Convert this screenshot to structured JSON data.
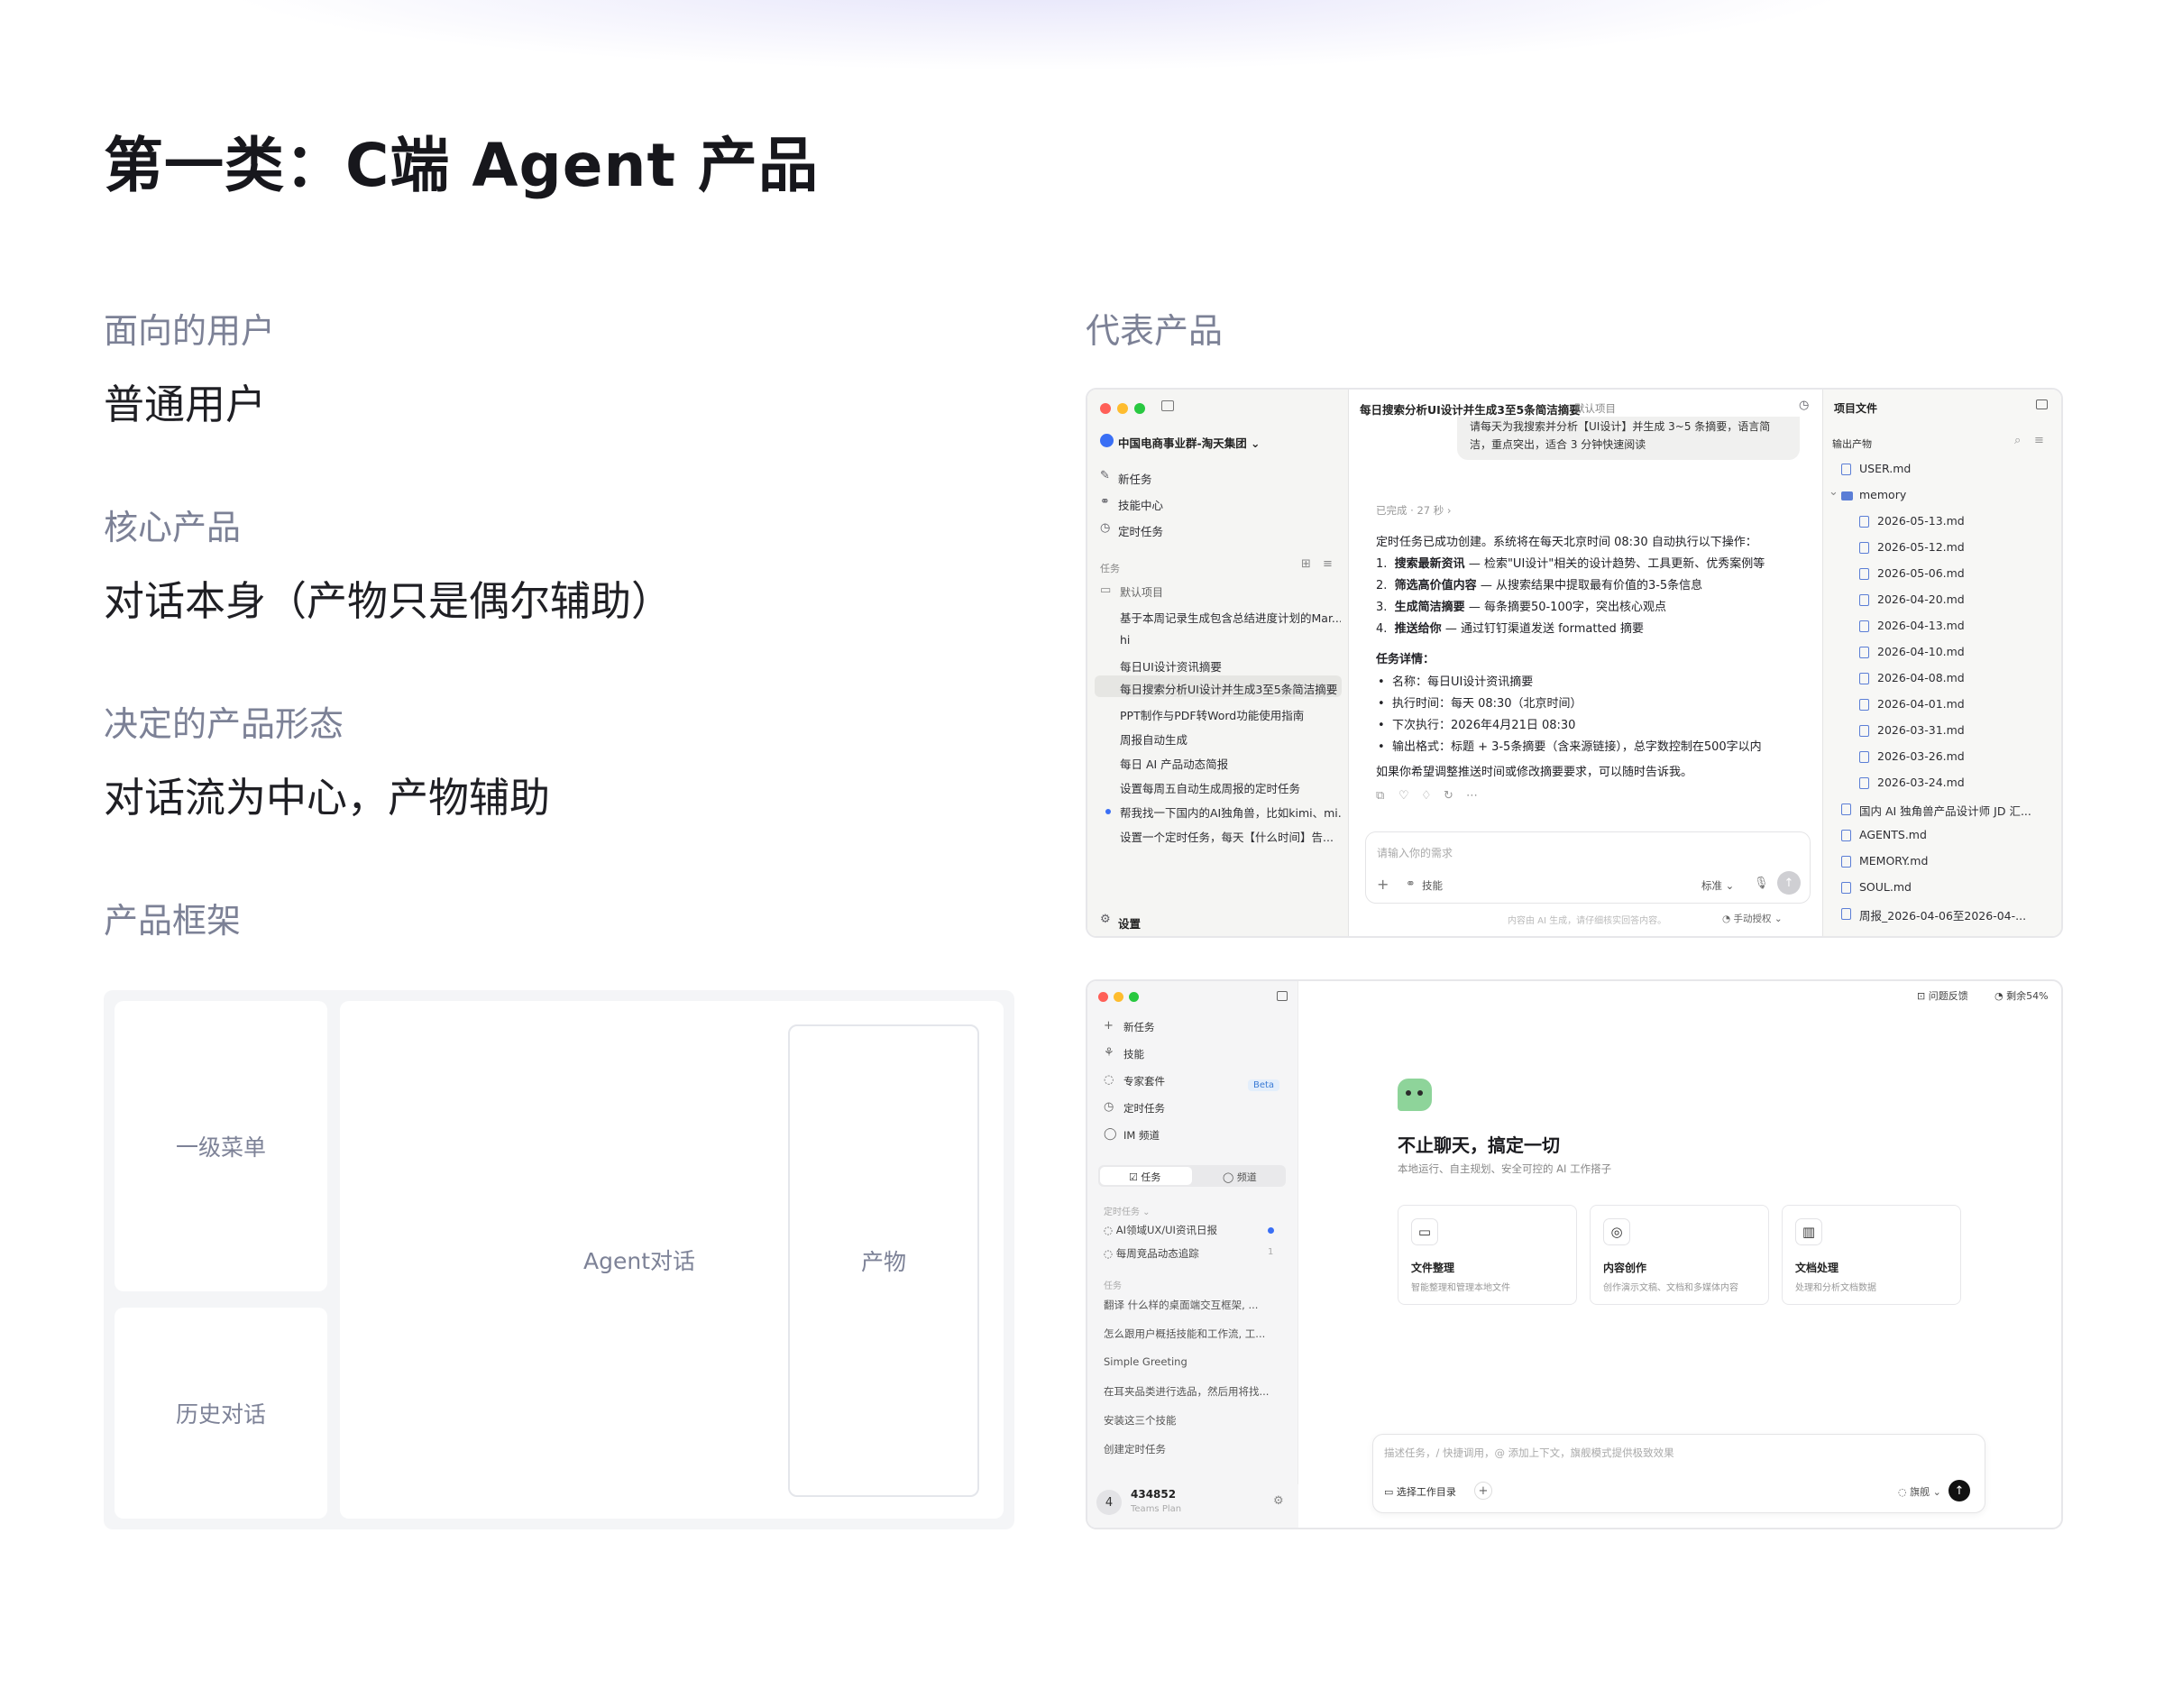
{
  "title": "第一类：C端 Agent 产品",
  "left": {
    "sections": [
      {
        "label": "面向的用户",
        "value": "普通用户"
      },
      {
        "label": "核心产品",
        "value": "对话本身（产物只是偶尔辅助）"
      },
      {
        "label": "决定的产品形态",
        "value": "对话流为中心，产物辅助"
      }
    ],
    "framework_label": "产品框架",
    "framework": {
      "menu": "一级菜单",
      "history": "历史对话",
      "agent": "Agent对话",
      "artifact": "产物"
    }
  },
  "right": {
    "label": "代表产品",
    "shot1": {
      "org": "中国电商事业群-淘天集团",
      "nav": [
        "新任务",
        "技能中心",
        "定时任务"
      ],
      "tasks_header": "任务",
      "project": "默认项目",
      "tasks": [
        "基于本周记录生成包含总结进度计划的Mar...",
        "hi",
        "每日UI设计资讯摘要",
        "每日搜索分析UI设计并生成3至5条简洁摘要",
        "PPT制作与PDF转Word功能使用指南",
        "周报自动生成",
        "每日 AI 产品动态简报",
        "设置每周五自动生成周报的定时任务",
        "帮我找一下国内的AI独角兽，比如kimi、mi...",
        "设置一个定时任务，每天【什么时间】告..."
      ],
      "settings": "设置",
      "header_title": "每日搜索分析UI设计并生成3至5条简洁摘要",
      "header_project": "默认项目",
      "bubble_line1": "请每天为我搜索并分析【UI设计】并生成 3~5 条摘要，语言简",
      "bubble_line2": "洁，重点突出，适合 3 分钟快速阅读",
      "done": "已完成 · 27 秒 ›",
      "intro": "定时任务已成功创建。系统将在每天北京时间 08:30 自动执行以下操作：",
      "steps": [
        {
          "b": "搜索最新资讯",
          "t": " — 检索\"UI设计\"相关的设计趋势、工具更新、优秀案例等"
        },
        {
          "b": "筛选高价值内容",
          "t": " — 从搜索结果中提取最有价值的3-5条信息"
        },
        {
          "b": "生成简洁摘要",
          "t": " — 每条摘要50-100字，突出核心观点"
        },
        {
          "b": "推送给你",
          "t": " — 通过钉钉渠道发送 formatted 摘要"
        }
      ],
      "details_title": "任务详情：",
      "details": [
        "名称：每日UI设计资讯摘要",
        "执行时间：每天 08:30（北京时间）",
        "下次执行：2026年4月21日 08:30",
        "输出格式：标题 + 3-5条摘要（含来源链接），总字数控制在500字以内"
      ],
      "closing": "如果你希望调整推送时间或修改摘要要求，可以随时告诉我。",
      "input_placeholder": "请输入你的需求",
      "skill": "技能",
      "mode": "标准",
      "disclaimer": "内容由 AI 生成，请仔细核实回答内容。",
      "auth": "手动授权",
      "files_header": "项目文件",
      "output_header": "输出产物",
      "files": [
        {
          "name": "USER.md",
          "indent": 0,
          "folder": false
        },
        {
          "name": "memory",
          "indent": 0,
          "folder": true
        },
        {
          "name": "2026-05-13.md",
          "indent": 1,
          "folder": false
        },
        {
          "name": "2026-05-12.md",
          "indent": 1,
          "folder": false
        },
        {
          "name": "2026-05-06.md",
          "indent": 1,
          "folder": false
        },
        {
          "name": "2026-04-20.md",
          "indent": 1,
          "folder": false
        },
        {
          "name": "2026-04-13.md",
          "indent": 1,
          "folder": false
        },
        {
          "name": "2026-04-10.md",
          "indent": 1,
          "folder": false
        },
        {
          "name": "2026-04-08.md",
          "indent": 1,
          "folder": false
        },
        {
          "name": "2026-04-01.md",
          "indent": 1,
          "folder": false
        },
        {
          "name": "2026-03-31.md",
          "indent": 1,
          "folder": false
        },
        {
          "name": "2026-03-26.md",
          "indent": 1,
          "folder": false
        },
        {
          "name": "2026-03-24.md",
          "indent": 1,
          "folder": false
        },
        {
          "name": "国内 AI 独角兽产品设计师 JD 汇...",
          "indent": 0,
          "folder": false
        },
        {
          "name": "AGENTS.md",
          "indent": 0,
          "folder": false
        },
        {
          "name": "MEMORY.md",
          "indent": 0,
          "folder": false
        },
        {
          "name": "SOUL.md",
          "indent": 0,
          "folder": false
        },
        {
          "name": "周报_2026-04-06至2026-04-...",
          "indent": 0,
          "folder": false
        }
      ]
    },
    "shot2": {
      "nav": [
        {
          "icon": "+",
          "label": "新任务"
        },
        {
          "icon": "⚘",
          "label": "技能"
        },
        {
          "icon": "◌",
          "label": "专家套件"
        },
        {
          "icon": "◷",
          "label": "定时任务"
        },
        {
          "icon": "◯",
          "label": "IM 频道"
        }
      ],
      "beta": "Beta",
      "tab_tasks": "任务",
      "tab_channels": "频道",
      "scheduled_header": "定时任务 ⌄",
      "scheduled": [
        "AI领域UX/UI资讯日报",
        "每周竞品动态追踪"
      ],
      "scheduled_count": "1",
      "tasks_header": "任务",
      "tasks": [
        "翻译 什么样的桌面端交互框架, ...",
        "怎么跟用户概括技能和工作流, 工...",
        "Simple Greeting",
        "在耳夹品类进行选品，然后用将找...",
        "安装这三个技能",
        "创建定时任务"
      ],
      "avatar": "4",
      "user": "434852",
      "plan": "Teams Plan",
      "feedback": "问题反馈",
      "remaining": "剩余54%",
      "headline": "不止聊天，搞定一切",
      "subline": "本地运行、自主规划、安全可控的 AI 工作搭子",
      "cards": [
        {
          "icon": "▭",
          "title": "文件整理",
          "desc": "智能整理和管理本地文件"
        },
        {
          "icon": "◎",
          "title": "内容创作",
          "desc": "创作演示文稿、文档和多媒体内容"
        },
        {
          "icon": "▥",
          "title": "文档处理",
          "desc": "处理和分析文档数据"
        }
      ],
      "input_placeholder": "描述任务，/ 快捷调用，@ 添加上下文，旗舰模式提供极致效果",
      "workdir": "选择工作目录",
      "mode": "旗舰"
    }
  }
}
